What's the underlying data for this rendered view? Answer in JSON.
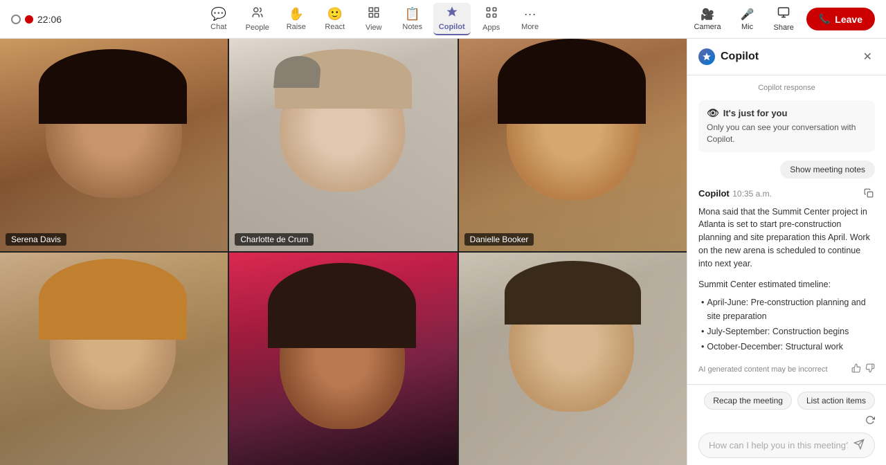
{
  "topbar": {
    "timer": "22:06",
    "nav_items": [
      {
        "id": "chat",
        "label": "Chat",
        "icon": "💬",
        "active": false
      },
      {
        "id": "people",
        "label": "People",
        "icon": "👥",
        "active": false
      },
      {
        "id": "raise",
        "label": "Raise",
        "icon": "✋",
        "active": false
      },
      {
        "id": "react",
        "label": "React",
        "icon": "😊",
        "active": false
      },
      {
        "id": "view",
        "label": "View",
        "icon": "⊞",
        "active": false
      },
      {
        "id": "notes",
        "label": "Notes",
        "icon": "📝",
        "active": false
      },
      {
        "id": "copilot",
        "label": "Copilot",
        "icon": "✦",
        "active": true
      },
      {
        "id": "apps",
        "label": "Apps",
        "icon": "⊞",
        "active": false
      },
      {
        "id": "more",
        "label": "More",
        "icon": "···",
        "active": false
      }
    ],
    "right_buttons": [
      {
        "id": "camera",
        "label": "Camera",
        "icon": "🎥"
      },
      {
        "id": "mic",
        "label": "Mic",
        "icon": "🎤"
      },
      {
        "id": "share",
        "label": "Share",
        "icon": "⬆"
      }
    ],
    "leave_label": "Leave"
  },
  "video_grid": {
    "participants": [
      {
        "id": "p1",
        "name": "Serena Davis",
        "show_label": true
      },
      {
        "id": "p2",
        "name": "Charlotte de Crum",
        "show_label": true
      },
      {
        "id": "p3",
        "name": "Danielle Booker",
        "show_label": true
      },
      {
        "id": "p4",
        "name": "",
        "show_label": false
      },
      {
        "id": "p5",
        "name": "",
        "show_label": false
      },
      {
        "id": "p6",
        "name": "",
        "show_label": false
      }
    ]
  },
  "copilot": {
    "title": "Copilot",
    "privacy_header": "It's just for you",
    "privacy_text": "Only you can see your conversation with Copilot.",
    "show_notes_label": "Show meeting notes",
    "message": {
      "sender": "Copilot",
      "time": "10:35 a.m.",
      "body": "Mona said that the Summit Center project in Atlanta is set to start pre-construction planning and site preparation this April. Work on the new arena is scheduled to continue into next year.",
      "timeline_header": "Summit Center estimated timeline:",
      "timeline_items": [
        "April-June: Pre-construction planning and site preparation",
        "July-September: Construction begins",
        "October-December: Structural work"
      ]
    },
    "ai_disclaimer": "AI generated content may be incorrect",
    "quick_actions": [
      {
        "id": "recap",
        "label": "Recap the meeting"
      },
      {
        "id": "actions",
        "label": "List action items"
      }
    ],
    "input_placeholder": "How can I help you in this meeting?"
  }
}
